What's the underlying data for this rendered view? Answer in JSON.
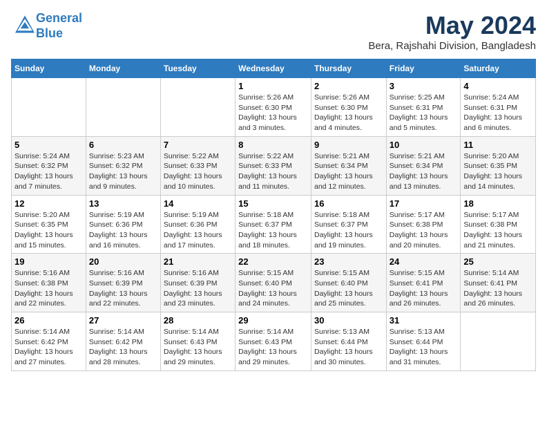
{
  "logo": {
    "line1": "General",
    "line2": "Blue"
  },
  "title": "May 2024",
  "location": "Bera, Rajshahi Division, Bangladesh",
  "weekdays": [
    "Sunday",
    "Monday",
    "Tuesday",
    "Wednesday",
    "Thursday",
    "Friday",
    "Saturday"
  ],
  "weeks": [
    [
      {
        "day": "",
        "info": ""
      },
      {
        "day": "",
        "info": ""
      },
      {
        "day": "",
        "info": ""
      },
      {
        "day": "1",
        "info": "Sunrise: 5:26 AM\nSunset: 6:30 PM\nDaylight: 13 hours and 3 minutes."
      },
      {
        "day": "2",
        "info": "Sunrise: 5:26 AM\nSunset: 6:30 PM\nDaylight: 13 hours and 4 minutes."
      },
      {
        "day": "3",
        "info": "Sunrise: 5:25 AM\nSunset: 6:31 PM\nDaylight: 13 hours and 5 minutes."
      },
      {
        "day": "4",
        "info": "Sunrise: 5:24 AM\nSunset: 6:31 PM\nDaylight: 13 hours and 6 minutes."
      }
    ],
    [
      {
        "day": "5",
        "info": "Sunrise: 5:24 AM\nSunset: 6:32 PM\nDaylight: 13 hours and 7 minutes."
      },
      {
        "day": "6",
        "info": "Sunrise: 5:23 AM\nSunset: 6:32 PM\nDaylight: 13 hours and 9 minutes."
      },
      {
        "day": "7",
        "info": "Sunrise: 5:22 AM\nSunset: 6:33 PM\nDaylight: 13 hours and 10 minutes."
      },
      {
        "day": "8",
        "info": "Sunrise: 5:22 AM\nSunset: 6:33 PM\nDaylight: 13 hours and 11 minutes."
      },
      {
        "day": "9",
        "info": "Sunrise: 5:21 AM\nSunset: 6:34 PM\nDaylight: 13 hours and 12 minutes."
      },
      {
        "day": "10",
        "info": "Sunrise: 5:21 AM\nSunset: 6:34 PM\nDaylight: 13 hours and 13 minutes."
      },
      {
        "day": "11",
        "info": "Sunrise: 5:20 AM\nSunset: 6:35 PM\nDaylight: 13 hours and 14 minutes."
      }
    ],
    [
      {
        "day": "12",
        "info": "Sunrise: 5:20 AM\nSunset: 6:35 PM\nDaylight: 13 hours and 15 minutes."
      },
      {
        "day": "13",
        "info": "Sunrise: 5:19 AM\nSunset: 6:36 PM\nDaylight: 13 hours and 16 minutes."
      },
      {
        "day": "14",
        "info": "Sunrise: 5:19 AM\nSunset: 6:36 PM\nDaylight: 13 hours and 17 minutes."
      },
      {
        "day": "15",
        "info": "Sunrise: 5:18 AM\nSunset: 6:37 PM\nDaylight: 13 hours and 18 minutes."
      },
      {
        "day": "16",
        "info": "Sunrise: 5:18 AM\nSunset: 6:37 PM\nDaylight: 13 hours and 19 minutes."
      },
      {
        "day": "17",
        "info": "Sunrise: 5:17 AM\nSunset: 6:38 PM\nDaylight: 13 hours and 20 minutes."
      },
      {
        "day": "18",
        "info": "Sunrise: 5:17 AM\nSunset: 6:38 PM\nDaylight: 13 hours and 21 minutes."
      }
    ],
    [
      {
        "day": "19",
        "info": "Sunrise: 5:16 AM\nSunset: 6:38 PM\nDaylight: 13 hours and 22 minutes."
      },
      {
        "day": "20",
        "info": "Sunrise: 5:16 AM\nSunset: 6:39 PM\nDaylight: 13 hours and 22 minutes."
      },
      {
        "day": "21",
        "info": "Sunrise: 5:16 AM\nSunset: 6:39 PM\nDaylight: 13 hours and 23 minutes."
      },
      {
        "day": "22",
        "info": "Sunrise: 5:15 AM\nSunset: 6:40 PM\nDaylight: 13 hours and 24 minutes."
      },
      {
        "day": "23",
        "info": "Sunrise: 5:15 AM\nSunset: 6:40 PM\nDaylight: 13 hours and 25 minutes."
      },
      {
        "day": "24",
        "info": "Sunrise: 5:15 AM\nSunset: 6:41 PM\nDaylight: 13 hours and 26 minutes."
      },
      {
        "day": "25",
        "info": "Sunrise: 5:14 AM\nSunset: 6:41 PM\nDaylight: 13 hours and 26 minutes."
      }
    ],
    [
      {
        "day": "26",
        "info": "Sunrise: 5:14 AM\nSunset: 6:42 PM\nDaylight: 13 hours and 27 minutes."
      },
      {
        "day": "27",
        "info": "Sunrise: 5:14 AM\nSunset: 6:42 PM\nDaylight: 13 hours and 28 minutes."
      },
      {
        "day": "28",
        "info": "Sunrise: 5:14 AM\nSunset: 6:43 PM\nDaylight: 13 hours and 29 minutes."
      },
      {
        "day": "29",
        "info": "Sunrise: 5:14 AM\nSunset: 6:43 PM\nDaylight: 13 hours and 29 minutes."
      },
      {
        "day": "30",
        "info": "Sunrise: 5:13 AM\nSunset: 6:44 PM\nDaylight: 13 hours and 30 minutes."
      },
      {
        "day": "31",
        "info": "Sunrise: 5:13 AM\nSunset: 6:44 PM\nDaylight: 13 hours and 31 minutes."
      },
      {
        "day": "",
        "info": ""
      }
    ]
  ]
}
